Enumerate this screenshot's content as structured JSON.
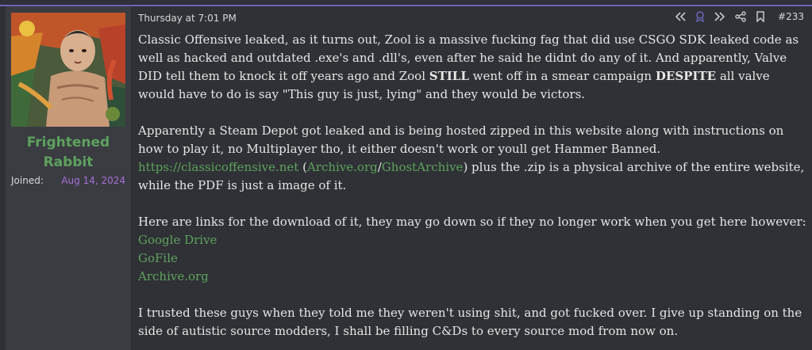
{
  "user": {
    "name": "Frightened Rabbit",
    "joined_label": "Joined:",
    "joined_date": "Aug 14, 2024"
  },
  "post": {
    "timestamp": "Thursday at 7:01 PM",
    "number": "#233",
    "p1_a": "Classic Offensive leaked, as it turns out, Zool is a massive fucking fag that did use CSGO SDK leaked code as well as hacked and outdated .exe's and .dll's, even after he said he didnt do any of it. And apparently, Valve DID tell them to knock it off years ago and Zool ",
    "p1_b1": "STILL",
    "p1_c": " went off in a smear campaign ",
    "p1_b2": "DESPITE",
    "p1_d": " all valve would have to do is say \"This guy is just, lying\" and they would be victors.",
    "p2_a": "Apparently a Steam Depot got leaked and is being hosted zipped in this website along with instructions on how to play it, no Multiplayer tho, it either doesn't work or youll get Hammer Banned.",
    "link_site": "https://classicoffensive.net",
    "paren_open": " (",
    "link_archive_org": "Archive.org",
    "slash": "/",
    "link_ghost": "GhostArchive",
    "p2_b": ") plus the .zip is a physical archive of the entire website, while the PDF is just a image of it.",
    "p3": "Here are links for the download of it, they may go down so if they no longer work when you get here however:",
    "link_gdrive": "Google Drive",
    "link_gofile": "GoFile",
    "link_archive": "Archive.org",
    "p4": "I trusted these guys when they told me they weren't using shit, and got fucked over. I give up standing on the side of autistic source modders, I shall be filling C&Ds to every source mod from now on."
  },
  "icons": [
    "rewind-icon",
    "badge-icon",
    "forward-icon",
    "share-icon",
    "bookmark-icon"
  ],
  "colors": {
    "accent": "#6a63b8",
    "username": "#5ea25d",
    "link": "#5ea25d",
    "joined_date": "#a770d8",
    "sidebar_bg": "#3a3c42",
    "main_bg": "#2f3136"
  }
}
